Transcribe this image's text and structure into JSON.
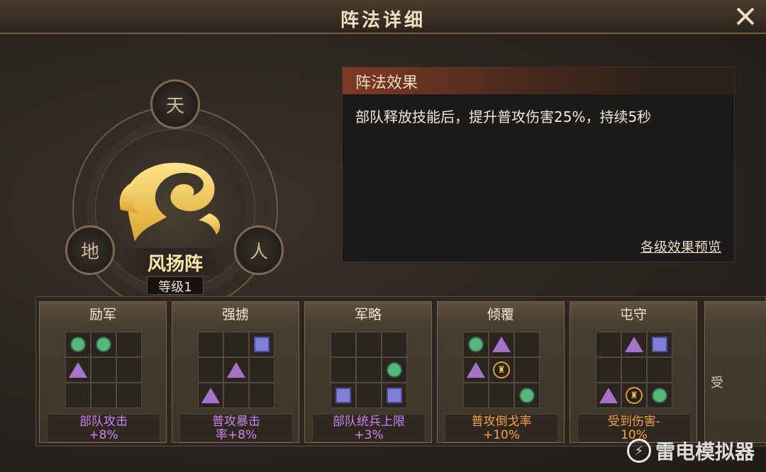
{
  "window": {
    "title": "阵法详细"
  },
  "formation": {
    "name": "风扬阵",
    "level_label": "等级1",
    "nodes": {
      "top": "天",
      "left": "地",
      "right": "人"
    }
  },
  "effect_panel": {
    "header": "阵法效果",
    "description": "部队释放技能后，提升普攻伤害25%，持续5秒",
    "preview_link": "各级效果预览"
  },
  "cards": [
    {
      "title": "励军",
      "effect_line1": "部队攻击",
      "effect_line2": "+8%",
      "color": "#c687ee",
      "grid": [
        "dot",
        "dot",
        "",
        "tri",
        "",
        "",
        "",
        "",
        ""
      ]
    },
    {
      "title": "强掳",
      "effect_line1": "普攻暴击",
      "effect_line2": "率+8%",
      "color": "#c687ee",
      "grid": [
        "",
        "",
        "sq",
        "",
        "tri",
        "",
        "tri",
        "",
        ""
      ]
    },
    {
      "title": "军略",
      "effect_line1": "部队统兵上限",
      "effect_line2": "+3%",
      "color": "#c687ee",
      "grid": [
        "",
        "",
        "",
        "",
        "",
        "dot",
        "sq",
        "",
        "sq"
      ]
    },
    {
      "title": "倾覆",
      "effect_line1": "普攻倒戈率",
      "effect_line2": "+10%",
      "color": "#f0a640",
      "grid": [
        "dot",
        "tri",
        "",
        "tri",
        "gen",
        "",
        "",
        "",
        "dot"
      ]
    },
    {
      "title": "屯守",
      "effect_line1": "受到伤害-",
      "effect_line2": "10%",
      "color": "#f0a640",
      "grid": [
        "",
        "tri",
        "sq",
        "",
        "",
        "",
        "tri",
        "gen",
        "dot"
      ]
    }
  ],
  "partial_card_text": "受",
  "watermark": "雷电模拟器"
}
